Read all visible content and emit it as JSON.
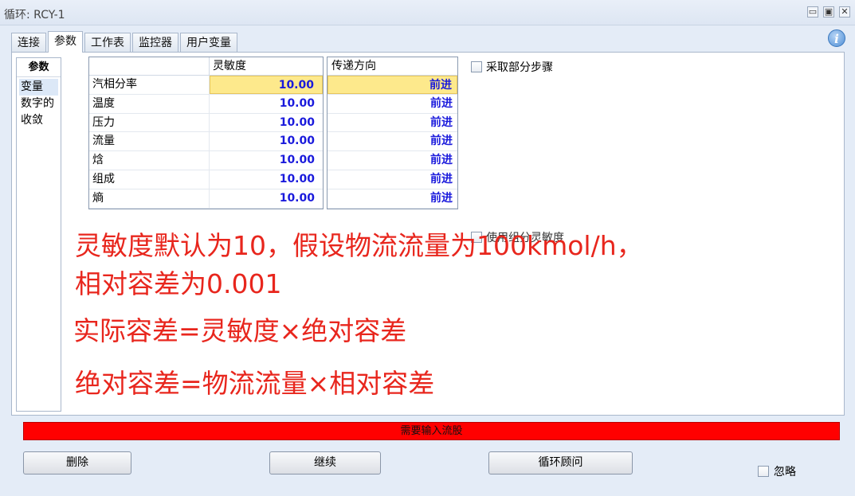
{
  "window": {
    "title": "循环: RCY-1",
    "min_glyph": "▭",
    "restore_glyph": "▣",
    "close_glyph": "✕"
  },
  "tabs": [
    {
      "label": "连接",
      "active": false
    },
    {
      "label": "参数",
      "active": true
    },
    {
      "label": "工作表",
      "active": false
    },
    {
      "label": "监控器",
      "active": false
    },
    {
      "label": "用户变量",
      "active": false
    }
  ],
  "info_icon": {
    "name": "info-icon",
    "glyph": "i"
  },
  "leftnav": {
    "header": "参数",
    "items": [
      {
        "label": "变量",
        "selected": true
      },
      {
        "label": "数字的",
        "selected": false
      },
      {
        "label": "收敛",
        "selected": false
      }
    ]
  },
  "sensitivity_table": {
    "header": "灵敏度",
    "rows": [
      {
        "label": "汽相分率",
        "value": "10.00"
      },
      {
        "label": "温度",
        "value": "10.00"
      },
      {
        "label": "压力",
        "value": "10.00"
      },
      {
        "label": "流量",
        "value": "10.00"
      },
      {
        "label": "焓",
        "value": "10.00"
      },
      {
        "label": "组成",
        "value": "10.00"
      },
      {
        "label": "熵",
        "value": "10.00"
      }
    ]
  },
  "direction_table": {
    "header": "传递方向",
    "rows": [
      "前进",
      "前进",
      "前进",
      "前进",
      "前进",
      "前进",
      "前进"
    ]
  },
  "checkboxes": {
    "partial_steps": "采取部分步骤",
    "use_comp_sensitivity": "使用组分灵敏度",
    "ignore": "忽略"
  },
  "annotations": {
    "line1": "灵敏度默认为10，假设物流流量为100kmol/h，",
    "line2": "相对容差为0.001",
    "line3": "实际容差=灵敏度×绝对容差",
    "line4": "绝对容差=物流流量×相对容差"
  },
  "status": {
    "text": "需要输入流股",
    "color": "#ff0000"
  },
  "buttons": {
    "delete": "删除",
    "continue": "继续",
    "advisor": "循环顾问"
  },
  "colors": {
    "highlight": "#fde98c",
    "value_text": "#1a1adc",
    "annotation": "#e8261d"
  }
}
